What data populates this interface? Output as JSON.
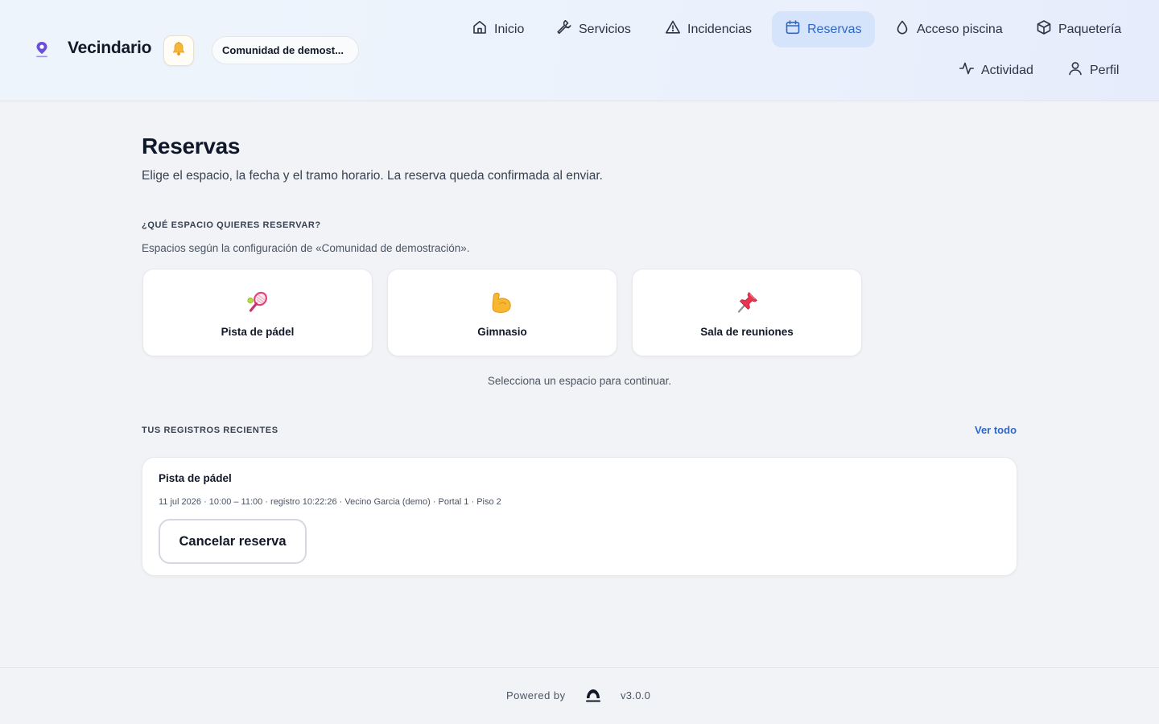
{
  "header": {
    "brand_name": "Vecindario",
    "community_name": "Comunidad de demost...",
    "notification_icon": "bell-icon",
    "nav": [
      {
        "label": "Inicio",
        "icon": "home-icon",
        "active": false
      },
      {
        "label": "Servicios",
        "icon": "wrench-icon",
        "active": false
      },
      {
        "label": "Incidencias",
        "icon": "warning-icon",
        "active": false
      },
      {
        "label": "Reservas",
        "icon": "calendar-icon",
        "active": true
      },
      {
        "label": "Acceso piscina",
        "icon": "droplet-icon",
        "active": false
      },
      {
        "label": "Paquetería",
        "icon": "package-icon",
        "active": false
      },
      {
        "label": "Actividad",
        "icon": "activity-icon",
        "active": false
      },
      {
        "label": "Perfil",
        "icon": "user-icon",
        "active": false
      }
    ]
  },
  "main": {
    "title": "Reservas",
    "subtitle": "Elige el espacio, la fecha y el tramo horario. La reserva queda confirmada al enviar.",
    "spaces_section": {
      "label": "¿QUÉ ESPACIO QUIERES RESERVAR?",
      "hint": "Espacios según la configuración de «Comunidad de demostración».",
      "spaces": [
        {
          "name": "Pista de pádel",
          "icon": "tennis-racket-icon"
        },
        {
          "name": "Gimnasio",
          "icon": "flexed-biceps-icon"
        },
        {
          "name": "Sala de reuniones",
          "icon": "pushpin-icon"
        }
      ],
      "select_hint": "Selecciona un espacio para continuar."
    },
    "recent_section": {
      "label": "TUS REGISTROS RECIENTES",
      "see_all": "Ver todo",
      "records": [
        {
          "title": "Pista de pádel",
          "meta": "11 jul 2026 · 10:00 – 11:00 · registro 10:22:26 · Vecino Garcia (demo) · Portal 1 · Piso 2",
          "cancel_label": "Cancelar reserva"
        }
      ]
    }
  },
  "footer": {
    "powered_by": "Powered by",
    "version": "v3.0.0"
  },
  "colors": {
    "accent": "#2f67c8",
    "active_nav_bg": "#d6e4fb",
    "background": "#f2f3f6"
  }
}
